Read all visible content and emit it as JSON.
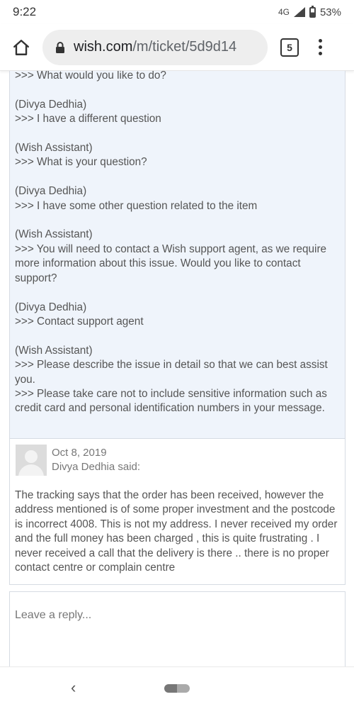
{
  "status": {
    "time": "9:22",
    "network": "4G",
    "battery": "53%"
  },
  "browser": {
    "url_host": "wish.com",
    "url_path": "/m/ticket/5d9d14",
    "tab_count": "5"
  },
  "chat_text": ">>> What would you like to do?\n\n(Divya Dedhia)\n>>> I have a different question\n\n(Wish Assistant)\n>>> What is your question?\n\n(Divya Dedhia)\n>>> I have some other question related to the item\n\n(Wish Assistant)\n>>> You will need to contact a Wish support agent, as we require more information about this issue. Would you like to contact support?\n\n(Divya Dedhia)\n>>> Contact support agent\n\n(Wish Assistant)\n>>> Please describe the issue in detail so that we can best assist you.\n>>> Please take care not to include sensitive information such as credit card and personal identification numbers in your message.",
  "reply": {
    "date": "Oct 8, 2019",
    "author": "Divya Dedhia said:",
    "body": "The tracking says that the order has been received, however the address mentioned is of some proper investment and the postcode is incorrect 4008. This is not my address. I never received my order and the full money has been charged , this is quite frustrating . I never received a call that the delivery is there .. there is no proper contact centre or complain centre"
  },
  "reply_input": {
    "placeholder": "Leave a reply..."
  },
  "icons": {
    "home": "home-icon",
    "lock": "lock-icon",
    "menu": "more-vert-icon",
    "back": "back-chevron-icon"
  }
}
